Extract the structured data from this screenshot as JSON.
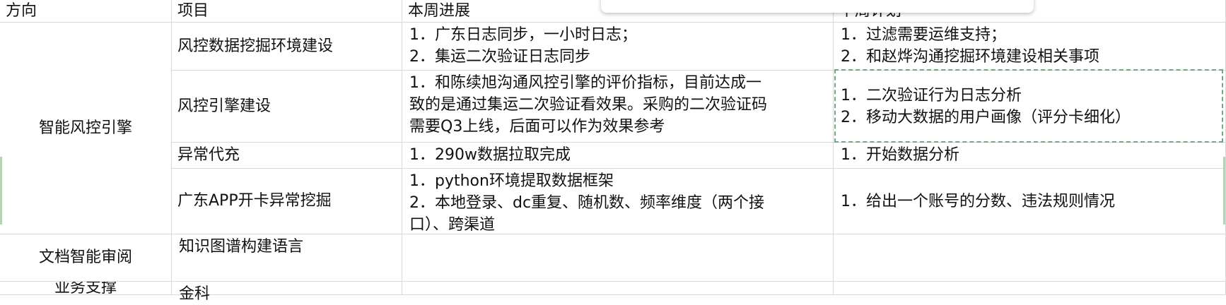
{
  "headers": [
    "方向",
    "项目",
    "本周进展",
    "下周计划"
  ],
  "directions": [
    "智能风控引擎",
    "文档智能审阅",
    "业务支撑"
  ],
  "rows": [
    {
      "project": "风控数据挖掘环境建设",
      "progress": [
        "1．广东日志同步，一小时日志；",
        "2．集运二次验证日志同步"
      ],
      "plan": [
        "1．过滤需要运维支持；",
        "2．和赵烨沟通挖掘环境建设相关事项"
      ]
    },
    {
      "project": "风控引擎建设",
      "progress": [
        "1．和陈续旭沟通风控引擎的评价指标，目前达成一",
        "致的是通过集运二次验证看效果。采购的二次验证码",
        "需要Q3上线，后面可以作为效果参考"
      ],
      "plan": [
        "1．二次验证行为日志分析",
        "2．移动大数据的用户画像（评分卡细化）"
      ]
    },
    {
      "project": "异常代充",
      "progress": [
        "1．290w数据拉取完成"
      ],
      "plan": [
        "1．开始数据分析"
      ]
    },
    {
      "project": "广东APP开卡异常挖掘",
      "progress": [
        "1．python环境提取数据框架",
        "2．本地登录、dc重复、随机数、频率维度（两个接",
        "口）、跨渠道"
      ],
      "plan": [
        "1．给出一个账号的分数、违法规则情况"
      ]
    },
    {
      "project": "知识图谱构建语言",
      "progress": [],
      "plan": []
    },
    {
      "project": "金科",
      "progress": [],
      "plan": []
    }
  ]
}
